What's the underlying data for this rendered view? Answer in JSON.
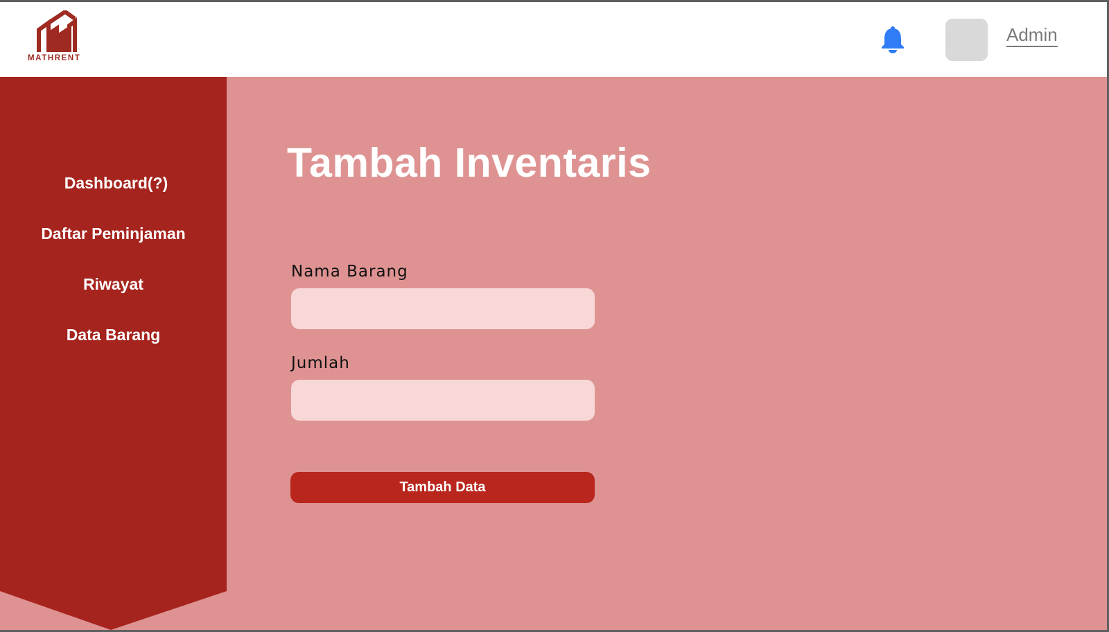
{
  "brand": {
    "name": "MATHRENT",
    "icon": "building-logo-icon",
    "color": "#9e2a22"
  },
  "header": {
    "notification_icon": "bell-icon",
    "user_label": "Admin"
  },
  "sidebar": {
    "color": "#a6241e",
    "items": [
      {
        "label": "Dashboard(?)"
      },
      {
        "label": "Daftar Peminjaman"
      },
      {
        "label": "Riwayat"
      },
      {
        "label": "Data Barang"
      }
    ]
  },
  "main": {
    "title": "Tambah Inventaris",
    "form": {
      "fields": [
        {
          "label": "Nama Barang",
          "value": "",
          "placeholder": ""
        },
        {
          "label": "Jumlah",
          "value": "",
          "placeholder": ""
        }
      ],
      "submit_label": "Tambah Data"
    }
  },
  "colors": {
    "background": "#de9392",
    "input_fill": "#f8d7d7",
    "button": "#b9261d",
    "bell": "#2f7cf6"
  }
}
